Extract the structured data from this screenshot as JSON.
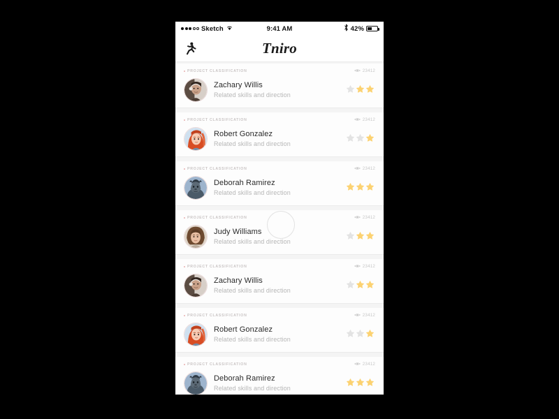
{
  "status_bar": {
    "carrier": "Sketch",
    "signal_dots_filled": 3,
    "signal_dots_total": 5,
    "wifi_icon": "wifi-icon",
    "time": "9:41 AM",
    "bluetooth_icon": "bluetooth-icon",
    "battery_percent": "42%",
    "battery_level": 42
  },
  "navbar": {
    "left_icon": "runner-icon",
    "title": "Tniro"
  },
  "colors": {
    "star_active": "#fcd271",
    "star_inactive": "#e3e3e3",
    "screen_bg": "#f4f4f4",
    "card_bg": "#fdfdfd",
    "category_text": "#c9c4c4",
    "views_text": "#c7c7c7",
    "name_text": "#2a2a2a",
    "subtitle_text": "#b6b6b6",
    "avatar_ring": "#eadada"
  },
  "list": {
    "category_label": "PROJECT CLASSIFICATION",
    "views_icon": "eye-icon",
    "cards": [
      {
        "category": "PROJECT CLASSIFICATION",
        "views": "23412",
        "name": "Zachary Willis",
        "subtitle": "Related skills and direction",
        "avatar": "avatar-photo-man-headset",
        "stars": [
          false,
          true,
          true
        ],
        "ripple": false
      },
      {
        "category": "PROJECT CLASSIFICATION",
        "views": "23412",
        "name": "Robert Gonzalez",
        "subtitle": "Related skills and direction",
        "avatar": "avatar-illustration-red-hair-woman",
        "stars": [
          false,
          false,
          true
        ],
        "ripple": false
      },
      {
        "category": "PROJECT CLASSIFICATION",
        "views": "23412",
        "name": "Deborah Ramirez",
        "subtitle": "Related skills and direction",
        "avatar": "avatar-illustration-dark-figure-blue",
        "stars": [
          true,
          true,
          true
        ],
        "ripple": false
      },
      {
        "category": "PROJECT CLASSIFICATION",
        "views": "23412",
        "name": "Judy Williams",
        "subtitle": "Related skills and direction",
        "avatar": "avatar-photo-curly-hair-woman",
        "stars": [
          false,
          true,
          true
        ],
        "ripple": true
      },
      {
        "category": "PROJECT CLASSIFICATION",
        "views": "23412",
        "name": "Zachary Willis",
        "subtitle": "Related skills and direction",
        "avatar": "avatar-photo-man-headset",
        "stars": [
          false,
          true,
          true
        ],
        "ripple": false
      },
      {
        "category": "PROJECT CLASSIFICATION",
        "views": "23412",
        "name": "Robert Gonzalez",
        "subtitle": "Related skills and direction",
        "avatar": "avatar-illustration-red-hair-woman",
        "stars": [
          false,
          false,
          true
        ],
        "ripple": false
      },
      {
        "category": "PROJECT CLASSIFICATION",
        "views": "23412",
        "name": "Deborah Ramirez",
        "subtitle": "Related skills and direction",
        "avatar": "avatar-illustration-dark-figure-blue",
        "stars": [
          true,
          true,
          true
        ],
        "ripple": false
      }
    ]
  }
}
